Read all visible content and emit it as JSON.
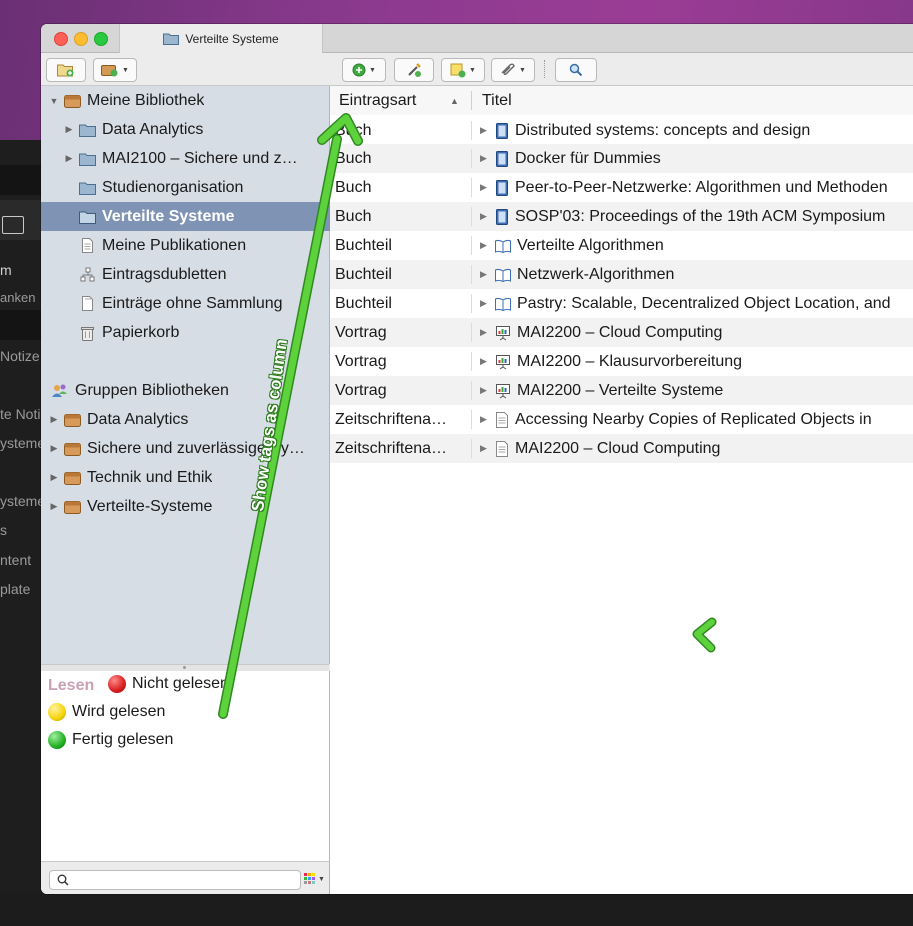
{
  "background_app": {
    "texts": [
      "m",
      "anken",
      "Notize",
      "te Noti",
      "ysteme",
      "ysteme",
      "s",
      "ntent",
      "plate"
    ]
  },
  "window": {
    "tab_title": "Verteilte Systeme"
  },
  "colors": {
    "selection": "#7f93b5",
    "annotation_arrow": "#5ed23c",
    "tag_red": "#d81e1e",
    "tag_yellow": "#f5d40a",
    "tag_green": "#22b022"
  },
  "toolbar": {
    "icons": [
      "new-collection-icon",
      "new-library-icon",
      "new-item-icon",
      "add-by-identifier-icon",
      "new-note-icon",
      "add-attachment-icon",
      "search-icon"
    ]
  },
  "library": {
    "items": [
      {
        "label": "Meine Bibliothek",
        "icon": "library-icon",
        "disclosure": "expanded"
      },
      {
        "label": "Data Analytics",
        "icon": "folder-icon",
        "disclosure": "collapsed"
      },
      {
        "label": "MAI2100 – Sichere und z…",
        "icon": "folder-icon",
        "disclosure": "collapsed"
      },
      {
        "label": "Studienorganisation",
        "icon": "folder-icon",
        "disclosure": ""
      },
      {
        "label": "Verteilte Systeme",
        "icon": "folder-icon",
        "disclosure": "",
        "selected": true
      },
      {
        "label": "Meine Publikationen",
        "icon": "document-icon",
        "disclosure": ""
      },
      {
        "label": "Eintragsdubletten",
        "icon": "duplicates-icon",
        "disclosure": ""
      },
      {
        "label": "Einträge ohne Sammlung",
        "icon": "unfiled-icon",
        "disclosure": ""
      },
      {
        "label": "Papierkorb",
        "icon": "trash-icon",
        "disclosure": ""
      }
    ],
    "groups_header": "Gruppen Bibliotheken",
    "groups": [
      {
        "label": "Data Analytics"
      },
      {
        "label": "Sichere und zuverlässige Sy…"
      },
      {
        "label": "Technik und Ethik"
      },
      {
        "label": "Verteilte-Systeme"
      }
    ]
  },
  "tags": {
    "title": "Lesen",
    "items": [
      {
        "label": "Nicht gelesen",
        "color": "red"
      },
      {
        "label": "Wird gelesen",
        "color": "yellow"
      },
      {
        "label": "Fertig gelesen",
        "color": "green"
      }
    ]
  },
  "table": {
    "columns": [
      "Eintragsart",
      "Titel"
    ],
    "sort_indicator": "▲",
    "rows": [
      {
        "type": "Buch",
        "title": "Distributed systems: concepts and design",
        "icon": "book-icon"
      },
      {
        "type": "Buch",
        "title": "Docker für Dummies",
        "icon": "book-icon"
      },
      {
        "type": "Buch",
        "title": "Peer-to-Peer-Netzwerke: Algorithmen und Methoden",
        "icon": "book-icon"
      },
      {
        "type": "Buch",
        "title": "SOSP'03: Proceedings of the 19th ACM Symposium",
        "icon": "book-icon"
      },
      {
        "type": "Buchteil",
        "title": "Verteilte Algorithmen",
        "icon": "book-section-icon"
      },
      {
        "type": "Buchteil",
        "title": "Netzwerk-Algorithmen",
        "icon": "book-section-icon"
      },
      {
        "type": "Buchteil",
        "title": "Pastry: Scalable, Decentralized Object Location, and",
        "icon": "book-section-icon"
      },
      {
        "type": "Vortrag",
        "title": "MAI2200 – Cloud Computing",
        "icon": "presentation-icon"
      },
      {
        "type": "Vortrag",
        "title": "MAI2200 – Klausurvorbereitung",
        "icon": "presentation-icon"
      },
      {
        "type": "Vortrag",
        "title": "MAI2200 – Verteilte Systeme",
        "icon": "presentation-icon"
      },
      {
        "type": "Zeitschriftena…",
        "title": "Accessing Nearby Copies of Replicated Objects in",
        "icon": "journal-article-icon"
      },
      {
        "type": "Zeitschriftena…",
        "title": "MAI2200 – Cloud Computing",
        "icon": "journal-article-icon"
      }
    ]
  },
  "annotation": {
    "text": "Show tags as column"
  }
}
